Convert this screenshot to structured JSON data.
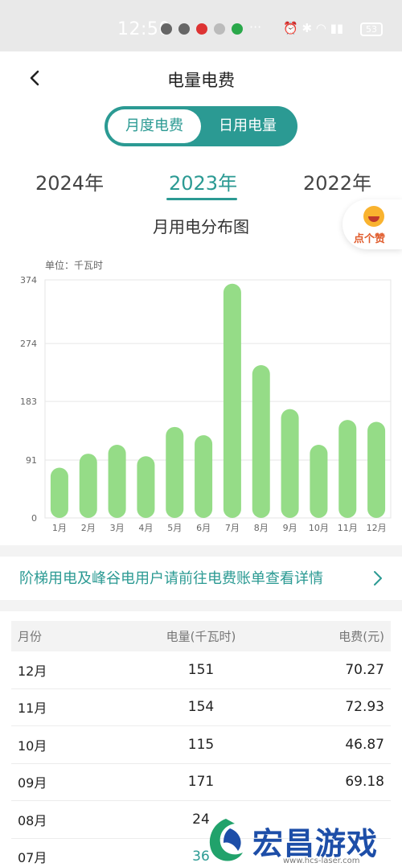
{
  "status": {
    "time": "12:50",
    "battery": "53"
  },
  "header": {
    "title": "电量电费"
  },
  "toggle": {
    "active": "月度电费",
    "inactive": "日用电量"
  },
  "years": [
    "2024年",
    "2023年",
    "2022年"
  ],
  "selected_year": "2023年",
  "chart_title": "月用电分布图",
  "like_label": "点个赞",
  "notice": "阶梯用电及峰谷电用户请前往电费账单查看详情",
  "table": {
    "headers": [
      "月份",
      "电量(千瓦时)",
      "电费(元)"
    ],
    "rows": [
      [
        "12月",
        "151",
        "70.27"
      ],
      [
        "11月",
        "154",
        "72.93"
      ],
      [
        "10月",
        "115",
        "46.87"
      ],
      [
        "09月",
        "171",
        "69.18"
      ],
      [
        "08月",
        "24",
        ""
      ],
      [
        "07月",
        "36",
        ""
      ]
    ]
  },
  "watermark": {
    "text": "宏昌游戏网",
    "url": "www.hcs-laser.com"
  },
  "colors": {
    "accent": "#2b9a93",
    "bar": "#95dc87"
  },
  "chart_data": {
    "type": "bar",
    "unit_label": "单位：千瓦时",
    "categories": [
      "1月",
      "2月",
      "3月",
      "4月",
      "5月",
      "6月",
      "7月",
      "8月",
      "9月",
      "10月",
      "11月",
      "12月"
    ],
    "values": [
      79,
      101,
      115,
      97,
      143,
      130,
      368,
      240,
      171,
      115,
      154,
      151
    ],
    "yticks": [
      0,
      91,
      183,
      274,
      374
    ],
    "ylim": [
      0,
      374
    ],
    "grid": true
  }
}
